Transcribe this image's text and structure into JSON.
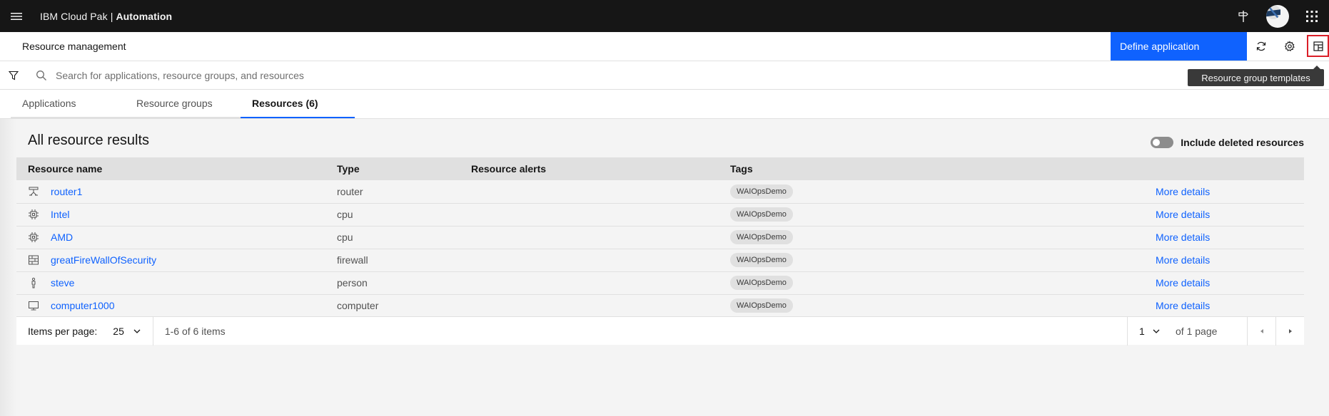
{
  "header": {
    "brand_prefix": "IBM Cloud Pak",
    "brand_separator": "|",
    "brand_product": "Automation",
    "icons": [
      "menu-icon",
      "signpost-icon",
      "user-avatar",
      "app-switcher-icon"
    ]
  },
  "subheader": {
    "title": "Resource management",
    "define_button": "Define application",
    "icons": [
      "refresh-icon",
      "settings-icon",
      "resource-group-templates-icon"
    ],
    "tooltip": "Resource group templates"
  },
  "search": {
    "placeholder": "Search for applications, resource groups, and resources"
  },
  "tabs": [
    {
      "label": "Applications"
    },
    {
      "label": "Resource groups"
    },
    {
      "label": "Resources (6)",
      "selected": true
    }
  ],
  "results": {
    "title": "All resource results",
    "toggle_label": "Include deleted resources",
    "toggle_on": false,
    "columns": [
      "Resource name",
      "Type",
      "Resource alerts",
      "Tags",
      ""
    ],
    "rows": [
      {
        "icon": "router-icon",
        "name": "router1",
        "type": "router",
        "alerts": "",
        "tag": "WAIOpsDemo",
        "action": "More details"
      },
      {
        "icon": "chip-icon",
        "name": "Intel",
        "type": "cpu",
        "alerts": "",
        "tag": "WAIOpsDemo",
        "action": "More details"
      },
      {
        "icon": "chip-icon",
        "name": "AMD",
        "type": "cpu",
        "alerts": "",
        "tag": "WAIOpsDemo",
        "action": "More details"
      },
      {
        "icon": "firewall-icon",
        "name": "greatFireWallOfSecurity",
        "type": "firewall",
        "alerts": "",
        "tag": "WAIOpsDemo",
        "action": "More details"
      },
      {
        "icon": "person-icon",
        "name": "steve",
        "type": "person",
        "alerts": "",
        "tag": "WAIOpsDemo",
        "action": "More details"
      },
      {
        "icon": "monitor-icon",
        "name": "computer1000",
        "type": "computer",
        "alerts": "",
        "tag": "WAIOpsDemo",
        "action": "More details"
      }
    ]
  },
  "pagination": {
    "items_per_page_label": "Items per page:",
    "items_per_page": "25",
    "range": "1-6 of 6 items",
    "page": "1",
    "of_pages": "of 1 page"
  },
  "colors": {
    "header_bg": "#161616",
    "primary": "#0f62fe",
    "highlight_border": "#da1e28"
  }
}
